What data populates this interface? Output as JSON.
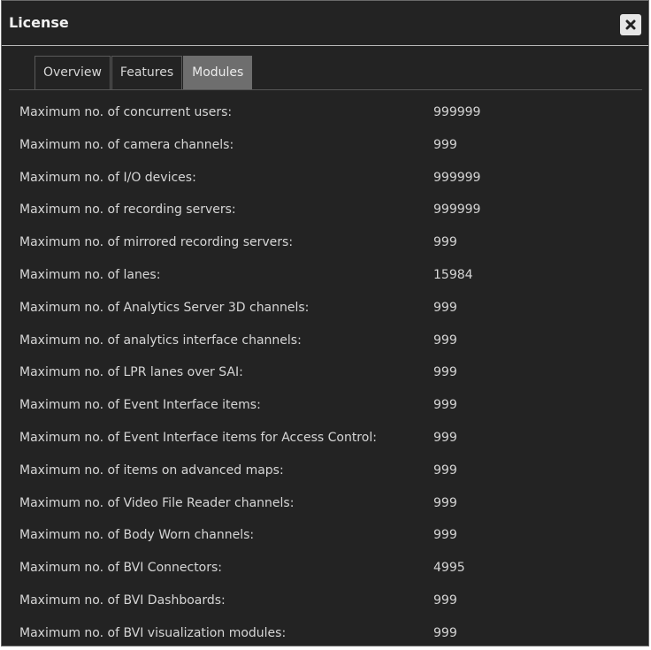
{
  "window": {
    "title": "License",
    "close_icon": "close-icon"
  },
  "tabs": [
    {
      "label": "Overview",
      "active": false
    },
    {
      "label": "Features",
      "active": false
    },
    {
      "label": "Modules",
      "active": true
    }
  ],
  "modules": [
    {
      "label": "Maximum no. of concurrent users:",
      "value": "999999"
    },
    {
      "label": "Maximum no. of camera channels:",
      "value": "999"
    },
    {
      "label": "Maximum no. of I/O devices:",
      "value": "999999"
    },
    {
      "label": "Maximum no. of recording servers:",
      "value": "999999"
    },
    {
      "label": "Maximum no. of mirrored recording servers:",
      "value": "999"
    },
    {
      "label": "Maximum no. of lanes:",
      "value": "15984"
    },
    {
      "label": "Maximum no. of Analytics Server 3D channels:",
      "value": "999"
    },
    {
      "label": "Maximum no. of analytics interface channels:",
      "value": "999"
    },
    {
      "label": "Maximum no. of LPR lanes over SAI:",
      "value": "999"
    },
    {
      "label": "Maximum no. of Event Interface items:",
      "value": "999"
    },
    {
      "label": "Maximum no. of Event Interface items for Access Control:",
      "value": "999"
    },
    {
      "label": "Maximum no. of items on advanced maps:",
      "value": "999"
    },
    {
      "label": "Maximum no. of Video File Reader channels:",
      "value": "999"
    },
    {
      "label": "Maximum no. of Body Worn channels:",
      "value": "999"
    },
    {
      "label": "Maximum no. of BVI Connectors:",
      "value": "4995"
    },
    {
      "label": "Maximum no. of BVI Dashboards:",
      "value": "999"
    },
    {
      "label": "Maximum no. of BVI visualization modules:",
      "value": "999"
    }
  ],
  "colors": {
    "background": "#232323",
    "active_tab": "#6e6e6e",
    "text": "#d6d6d6"
  }
}
